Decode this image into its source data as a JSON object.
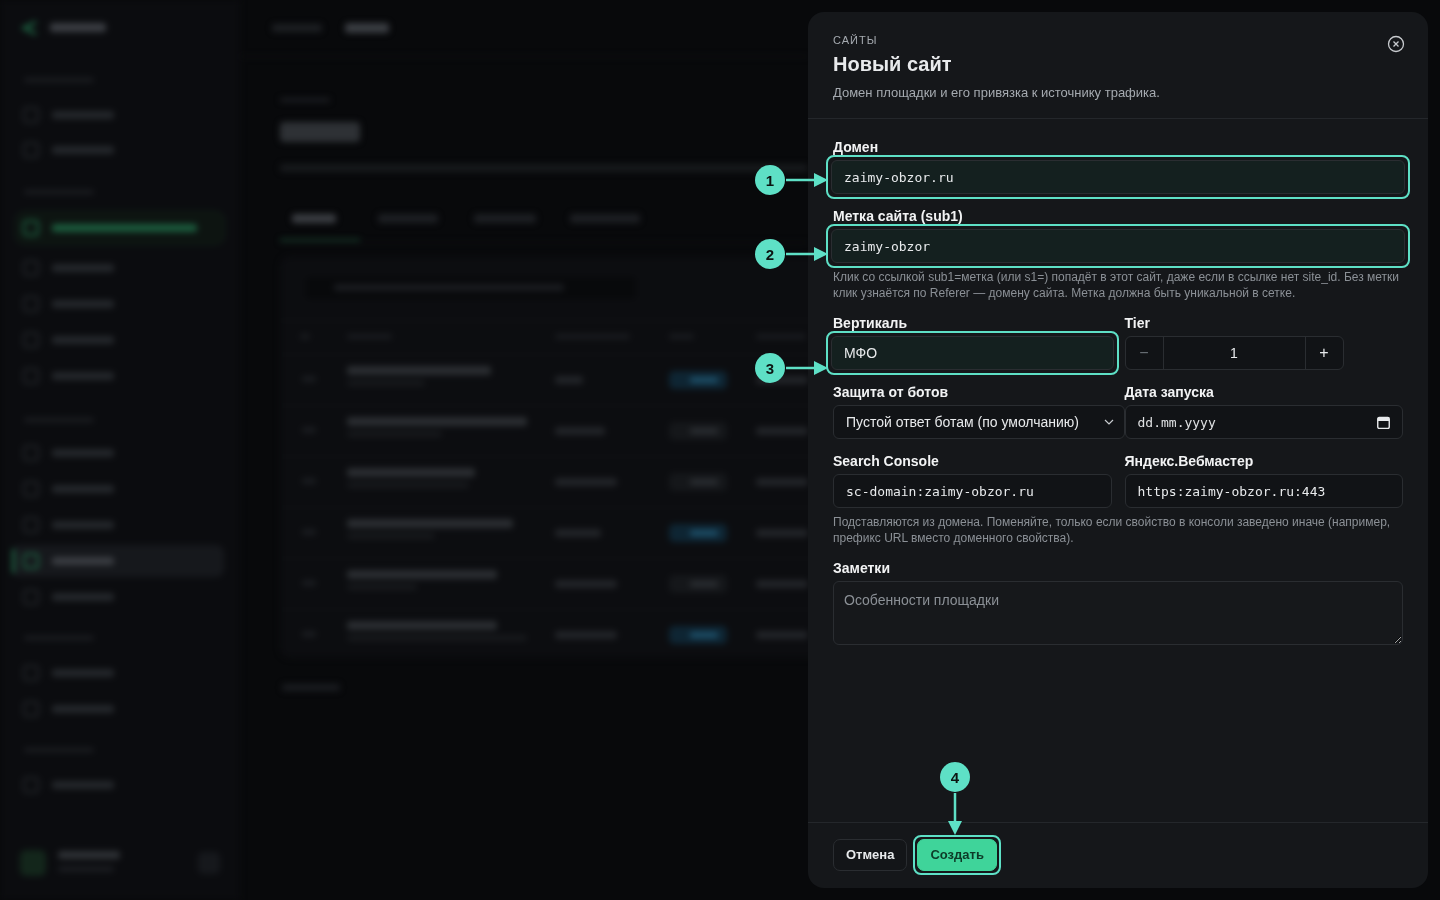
{
  "modal": {
    "section": "САЙТЫ",
    "title": "Новый сайт",
    "subtitle": "Домен площадки и его привязка к источнику трафика.",
    "rows": [
      {
        "kind": "fields",
        "fields": [
          {
            "kind": "code",
            "label": "Домен",
            "value": "zaimy-obzor.ru",
            "highlighted": true
          }
        ]
      },
      {
        "kind": "fields",
        "fields": [
          {
            "kind": "code",
            "label": "Метка сайта (sub1)",
            "value": "zaimy-obzor",
            "highlighted": true
          }
        ]
      },
      {
        "kind": "hint",
        "text": "Клик со ссылкой sub1=метка (или s1=) попадёт в этот сайт, даже если в ссылке нет site_id. Без метки клик узнаётся по Referer — домену сайта. Метка должна быть уникальной в сетке."
      },
      {
        "kind": "fields",
        "fields": [
          {
            "kind": "text",
            "label": "Вертикаль",
            "value": "МФО",
            "highlighted": true
          },
          {
            "kind": "stepper",
            "label": "Tier",
            "value": "1",
            "minus": "−",
            "plus": "+",
            "highlighted": false
          }
        ]
      },
      {
        "kind": "fields",
        "fields": [
          {
            "kind": "select",
            "label": "Защита от ботов",
            "value": "Пустой ответ ботам (по умолчанию)",
            "highlighted": false
          },
          {
            "kind": "date",
            "label": "Дата запуска",
            "placeholder": "dd.mm.yyyy",
            "highlighted": false
          }
        ]
      },
      {
        "kind": "fields",
        "fields": [
          {
            "kind": "code",
            "label": "Search Console",
            "value": "sc-domain:zaimy-obzor.ru",
            "highlighted": false
          },
          {
            "kind": "code",
            "label": "Яндекс.Вебмастер",
            "value": "https:zaimy-obzor.ru:443",
            "highlighted": false
          }
        ]
      },
      {
        "kind": "hint",
        "text": "Подставляются из домена. Поменяйте, только если свойство в консоли заведено иначе (например, префикс URL вместо доменного свойства)."
      },
      {
        "kind": "fields",
        "fields": [
          {
            "kind": "textarea",
            "label": "Заметки",
            "placeholder": "Особенности площадки",
            "highlighted": false
          }
        ]
      }
    ],
    "buttons": [
      {
        "label": "Отмена",
        "kind": "secondary",
        "highlighted": false
      },
      {
        "label": "Создать",
        "kind": "primary",
        "highlighted": true
      }
    ]
  },
  "callouts": [
    {
      "number": "1",
      "kind": "right"
    },
    {
      "number": "2",
      "kind": "right"
    },
    {
      "number": "3",
      "kind": "right"
    },
    {
      "number": "4",
      "kind": "down"
    }
  ]
}
